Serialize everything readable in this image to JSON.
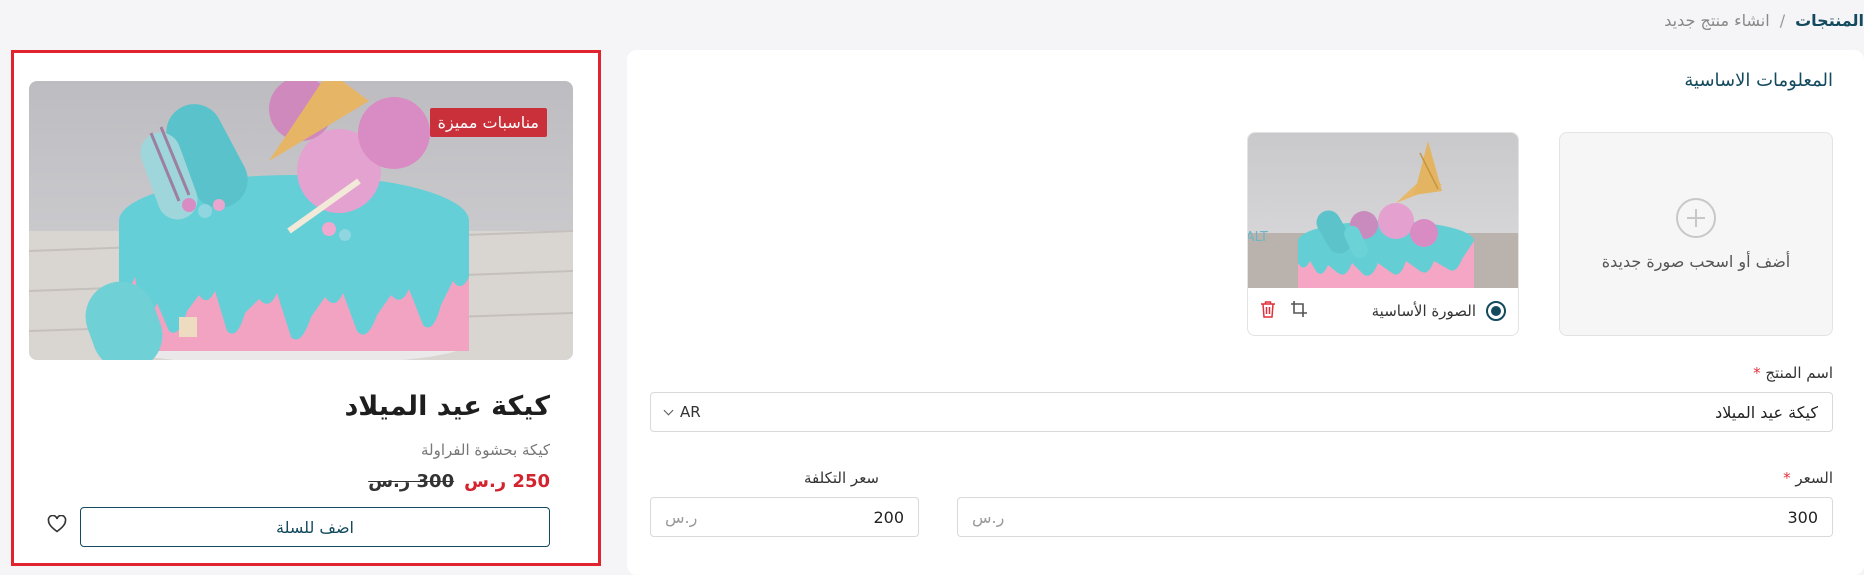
{
  "breadcrumb": {
    "root": "المنتجات",
    "separator": "/",
    "current": "انشاء منتج جديد"
  },
  "form": {
    "section_title": "المعلومات الاساسية",
    "upload_label": "أضف أو اسحب صورة جديدة",
    "image_tile": {
      "primary_label": "الصورة الأساسية",
      "alt_text": "ALT"
    },
    "name_label": "اسم المنتج",
    "required_mark": "*",
    "name_value": "كيكة عيد الميلاد",
    "language": "AR",
    "price_label": "السعر",
    "price_value": "300",
    "price_unit": "ر.س",
    "cost_label": "سعر التكلفة",
    "cost_value": "200",
    "cost_unit": "ر.س"
  },
  "preview": {
    "badge": "مناسبات مميزة",
    "name": "كيكة عيد الميلاد",
    "description": "كيكة بحشوة الفراولة",
    "price_new": "250 ر.س",
    "price_old": "300 ر.س",
    "add_to_cart": "اضف للسلة"
  },
  "icons": {
    "upload": "plus-circle-icon",
    "crop": "crop-icon",
    "delete": "trash-icon",
    "wishlist": "heart-icon",
    "dropdown": "chevron-down-icon"
  },
  "colors": {
    "primary": "#134a5e",
    "accent_red": "#d2232e",
    "badge_red": "#c9303a",
    "highlight_frame": "#e0242f"
  }
}
